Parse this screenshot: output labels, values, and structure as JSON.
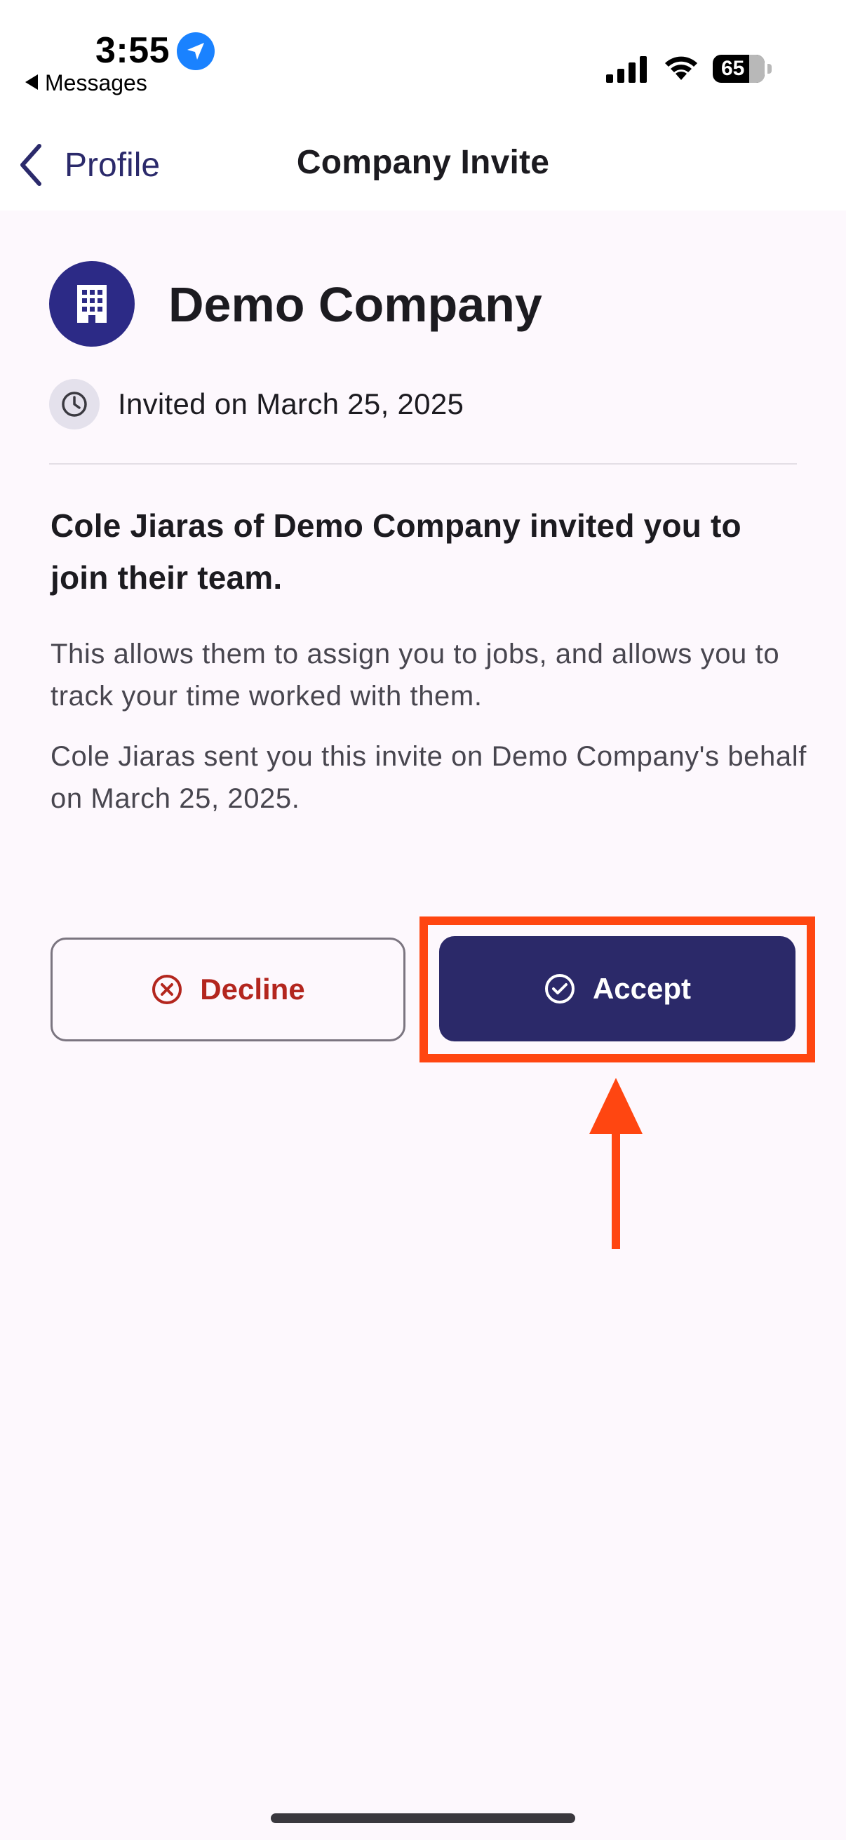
{
  "status_bar": {
    "time": "3:55",
    "back_app": "Messages",
    "battery": "65",
    "icons": [
      "location-arrow-icon",
      "cellular-signal-icon",
      "wifi-icon",
      "battery-icon"
    ]
  },
  "nav": {
    "back_label": "Profile",
    "title": "Company Invite"
  },
  "company": {
    "name": "Demo Company",
    "icon": "building-icon",
    "invited_date": "Invited on March 25, 2025"
  },
  "invite": {
    "heading": "Cole Jiaras of Demo Company invited you to join their team.",
    "description_1": "This allows them to assign you to jobs, and allows you to track your time worked with them.",
    "description_2": "Cole Jiaras sent you this invite on Demo Company's behalf on March 25, 2025."
  },
  "actions": {
    "decline_label": "Decline",
    "accept_label": "Accept"
  },
  "colors": {
    "primary": "#2b2969",
    "avatar": "#2c2a86",
    "decline": "#b3261e",
    "annotation": "#ff4611",
    "background": "#fdf8fd"
  }
}
